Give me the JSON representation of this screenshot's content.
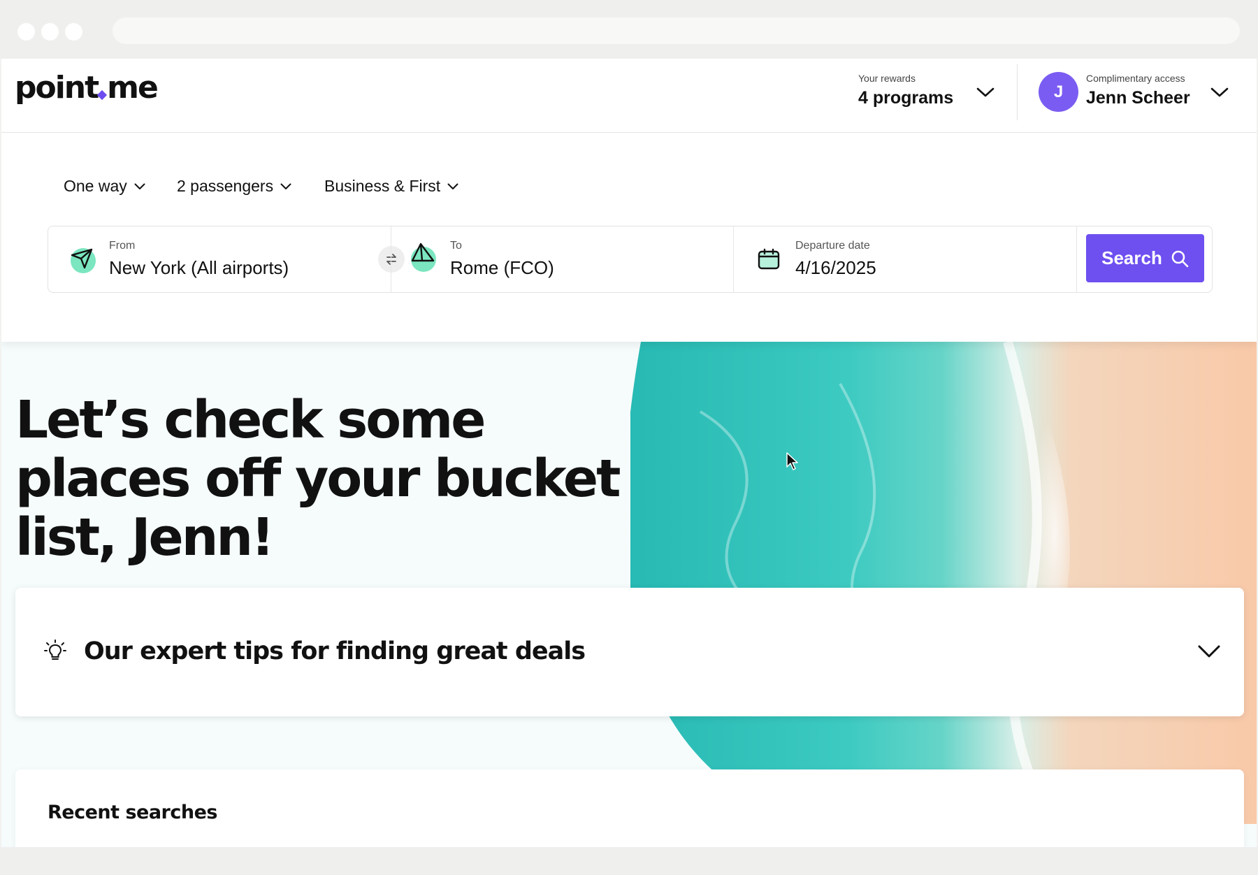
{
  "header": {
    "logo_text_a": "point",
    "logo_text_b": "me",
    "rewards_label": "Your rewards",
    "rewards_value": "4 programs",
    "account_label": "Complimentary access",
    "account_name": "Jenn Scheer",
    "avatar_initial": "J"
  },
  "search": {
    "trip_type": "One way",
    "passengers": "2 passengers",
    "cabin": "Business & First",
    "from_label": "From",
    "from_value": "New York (All airports)",
    "to_label": "To",
    "to_value": "Rome (FCO)",
    "date_label": "Departure date",
    "date_value": "4/16/2025",
    "search_label": "Search"
  },
  "hero": {
    "title": "Let’s check some places off your bucket list, Jenn!"
  },
  "tips": {
    "title": "Our expert tips for finding great deals"
  },
  "recent": {
    "title": "Recent searches"
  },
  "colors": {
    "brand_purple": "#6e4ff0",
    "avatar_purple": "#7b5cf2",
    "mint_accent": "#7be6c0",
    "ocean": "#3fc9c0",
    "sand": "#f6c7a4"
  },
  "icons": [
    "plane-departure-icon",
    "plane-arrival-icon",
    "swap-icon",
    "calendar-icon",
    "search-icon",
    "lightbulb-icon",
    "chevron-down-icon"
  ]
}
